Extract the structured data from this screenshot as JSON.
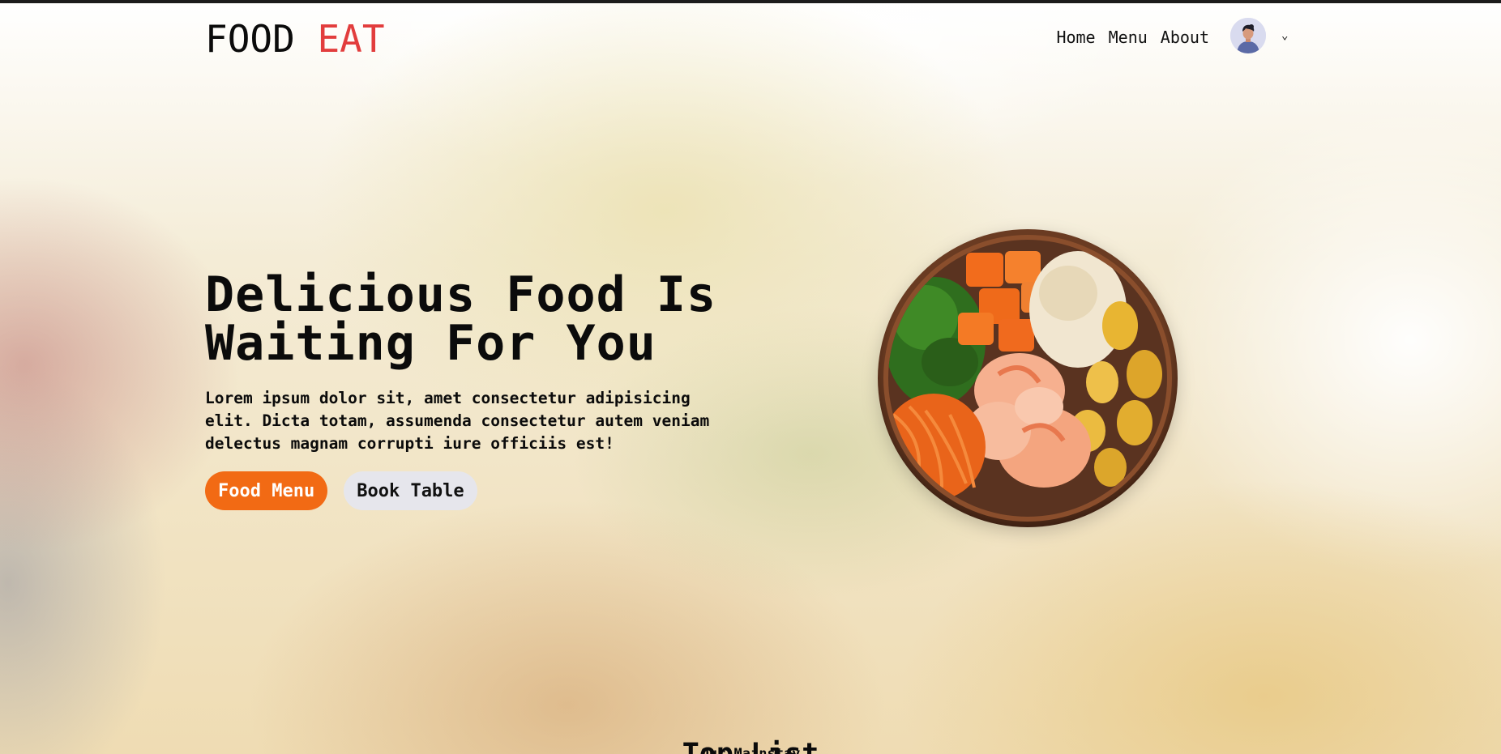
{
  "brand": {
    "part1": "FOOD",
    "part2": "EAT",
    "accent_color": "#e23d3d"
  },
  "nav": {
    "links": [
      "Home",
      "Menu",
      "About"
    ],
    "avatar_icon": "user-avatar-icon",
    "dropdown_icon": "chevron-down-icon",
    "dropdown_glyph": "⌄"
  },
  "hero": {
    "title_line1": "Delicious Food Is",
    "title_line2": "Waiting For You",
    "description": "Lorem ipsum dolor sit, amet consectetur adipisicing elit. Dicta totam, assumenda consectetur autem veniam delectus magnam corrupti iure officiis est!",
    "primary_button": "Food Menu",
    "secondary_button": "Book Table",
    "primary_color": "#f26a14",
    "image": "poke-bowl-image"
  },
  "section": {
    "title": "Top List",
    "subtitle": "Our Mainstay"
  }
}
